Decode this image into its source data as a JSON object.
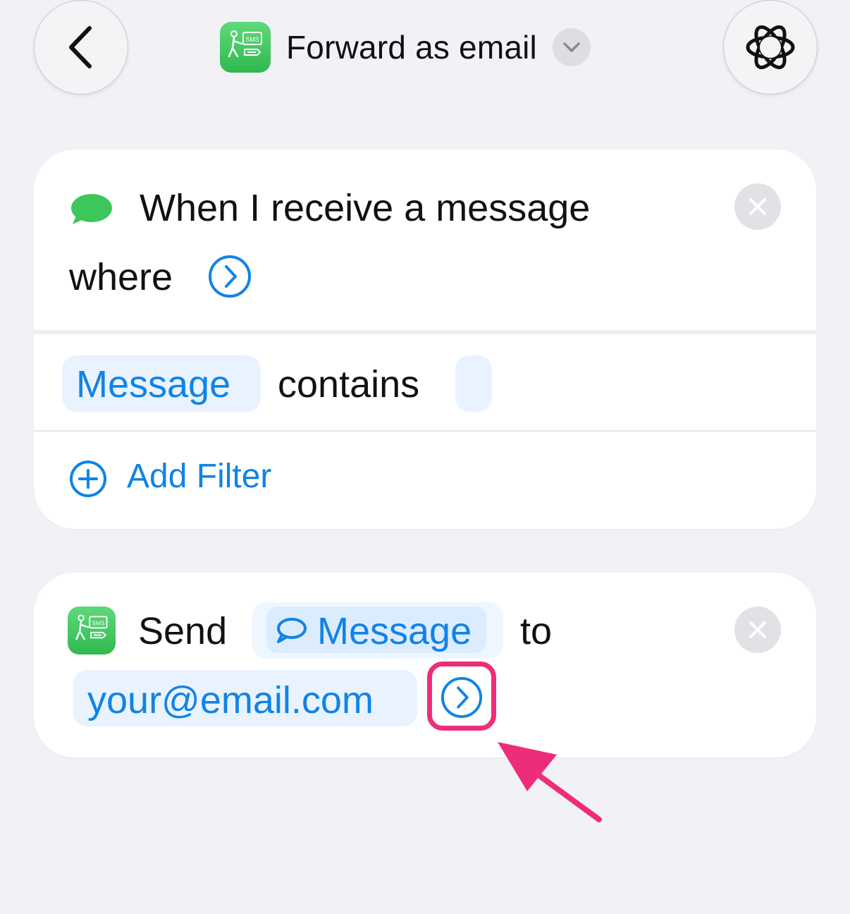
{
  "header": {
    "title": "Forward as email",
    "app_icon_text": "SMS",
    "icons": {
      "back": "chevron-left-icon",
      "dropdown": "chevron-down-icon",
      "ai": "apple-intelligence-icon"
    }
  },
  "trigger_card": {
    "line1": "When I receive a message",
    "line2": "where",
    "filter": {
      "field": "Message",
      "operator": "contains",
      "value": ""
    },
    "add_filter_label": "Add Filter",
    "icons": {
      "messages": "messages-bubble-icon",
      "expand": "chevron-right-circle-icon",
      "add": "plus-circle-icon",
      "remove": "close-icon"
    }
  },
  "action_card": {
    "verb": "Send",
    "variable": "Message",
    "preposition": "to",
    "recipient": "your@email.com",
    "icons": {
      "variable": "speech-bubble-icon",
      "expand": "chevron-right-circle-icon",
      "remove": "close-icon"
    }
  },
  "colors": {
    "accent": "#1183e6",
    "highlight": "#ee2d7a",
    "background": "#f2f1f6",
    "app_green": "#34c759"
  }
}
